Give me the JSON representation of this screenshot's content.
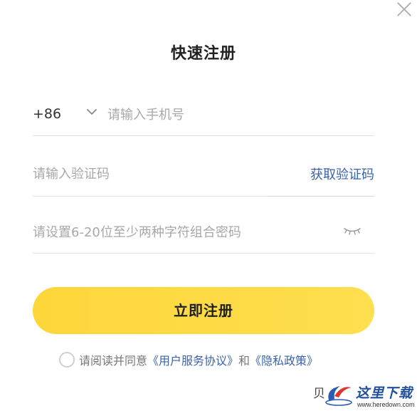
{
  "dialog": {
    "title": "快速注册",
    "close_icon": "close-icon"
  },
  "phone": {
    "country_code": "+86",
    "placeholder": "请输入手机号",
    "value": ""
  },
  "verification": {
    "placeholder": "请输入验证码",
    "value": "",
    "get_code_label": "获取验证码"
  },
  "password": {
    "placeholder": "请设置6-20位至少两种字符组合密码",
    "value": "",
    "visibility_icon": "eye-closed-icon"
  },
  "submit": {
    "label": "立即注册"
  },
  "agreement": {
    "prefix": "请阅读并同意",
    "terms_link": "《用户服务协议》",
    "conjunction": "和",
    "privacy_link": "《隐私政策》",
    "checked": false
  },
  "watermark": {
    "mark": "贝",
    "text": "这里下载",
    "url": "www.heredown.com"
  },
  "colors": {
    "accent_yellow": "#fdd63a",
    "link_blue": "#3a63a8",
    "placeholder_gray": "#a8a8a8"
  }
}
